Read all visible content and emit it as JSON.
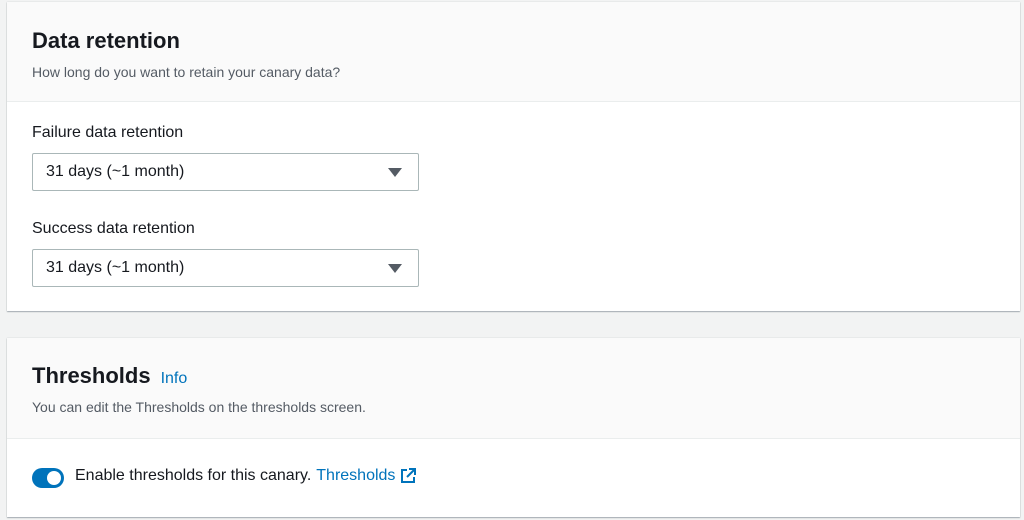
{
  "data_retention": {
    "title": "Data retention",
    "description": "How long do you want to retain your canary data?",
    "failure_label": "Failure data retention",
    "failure_value": "31 days (~1 month)",
    "success_label": "Success data retention",
    "success_value": "31 days (~1 month)"
  },
  "thresholds": {
    "title": "Thresholds",
    "info_link": "Info",
    "description": "You can edit the Thresholds on the thresholds screen.",
    "toggle_label": "Enable thresholds for this canary.",
    "toggle_on": true,
    "thresholds_link": "Thresholds"
  }
}
